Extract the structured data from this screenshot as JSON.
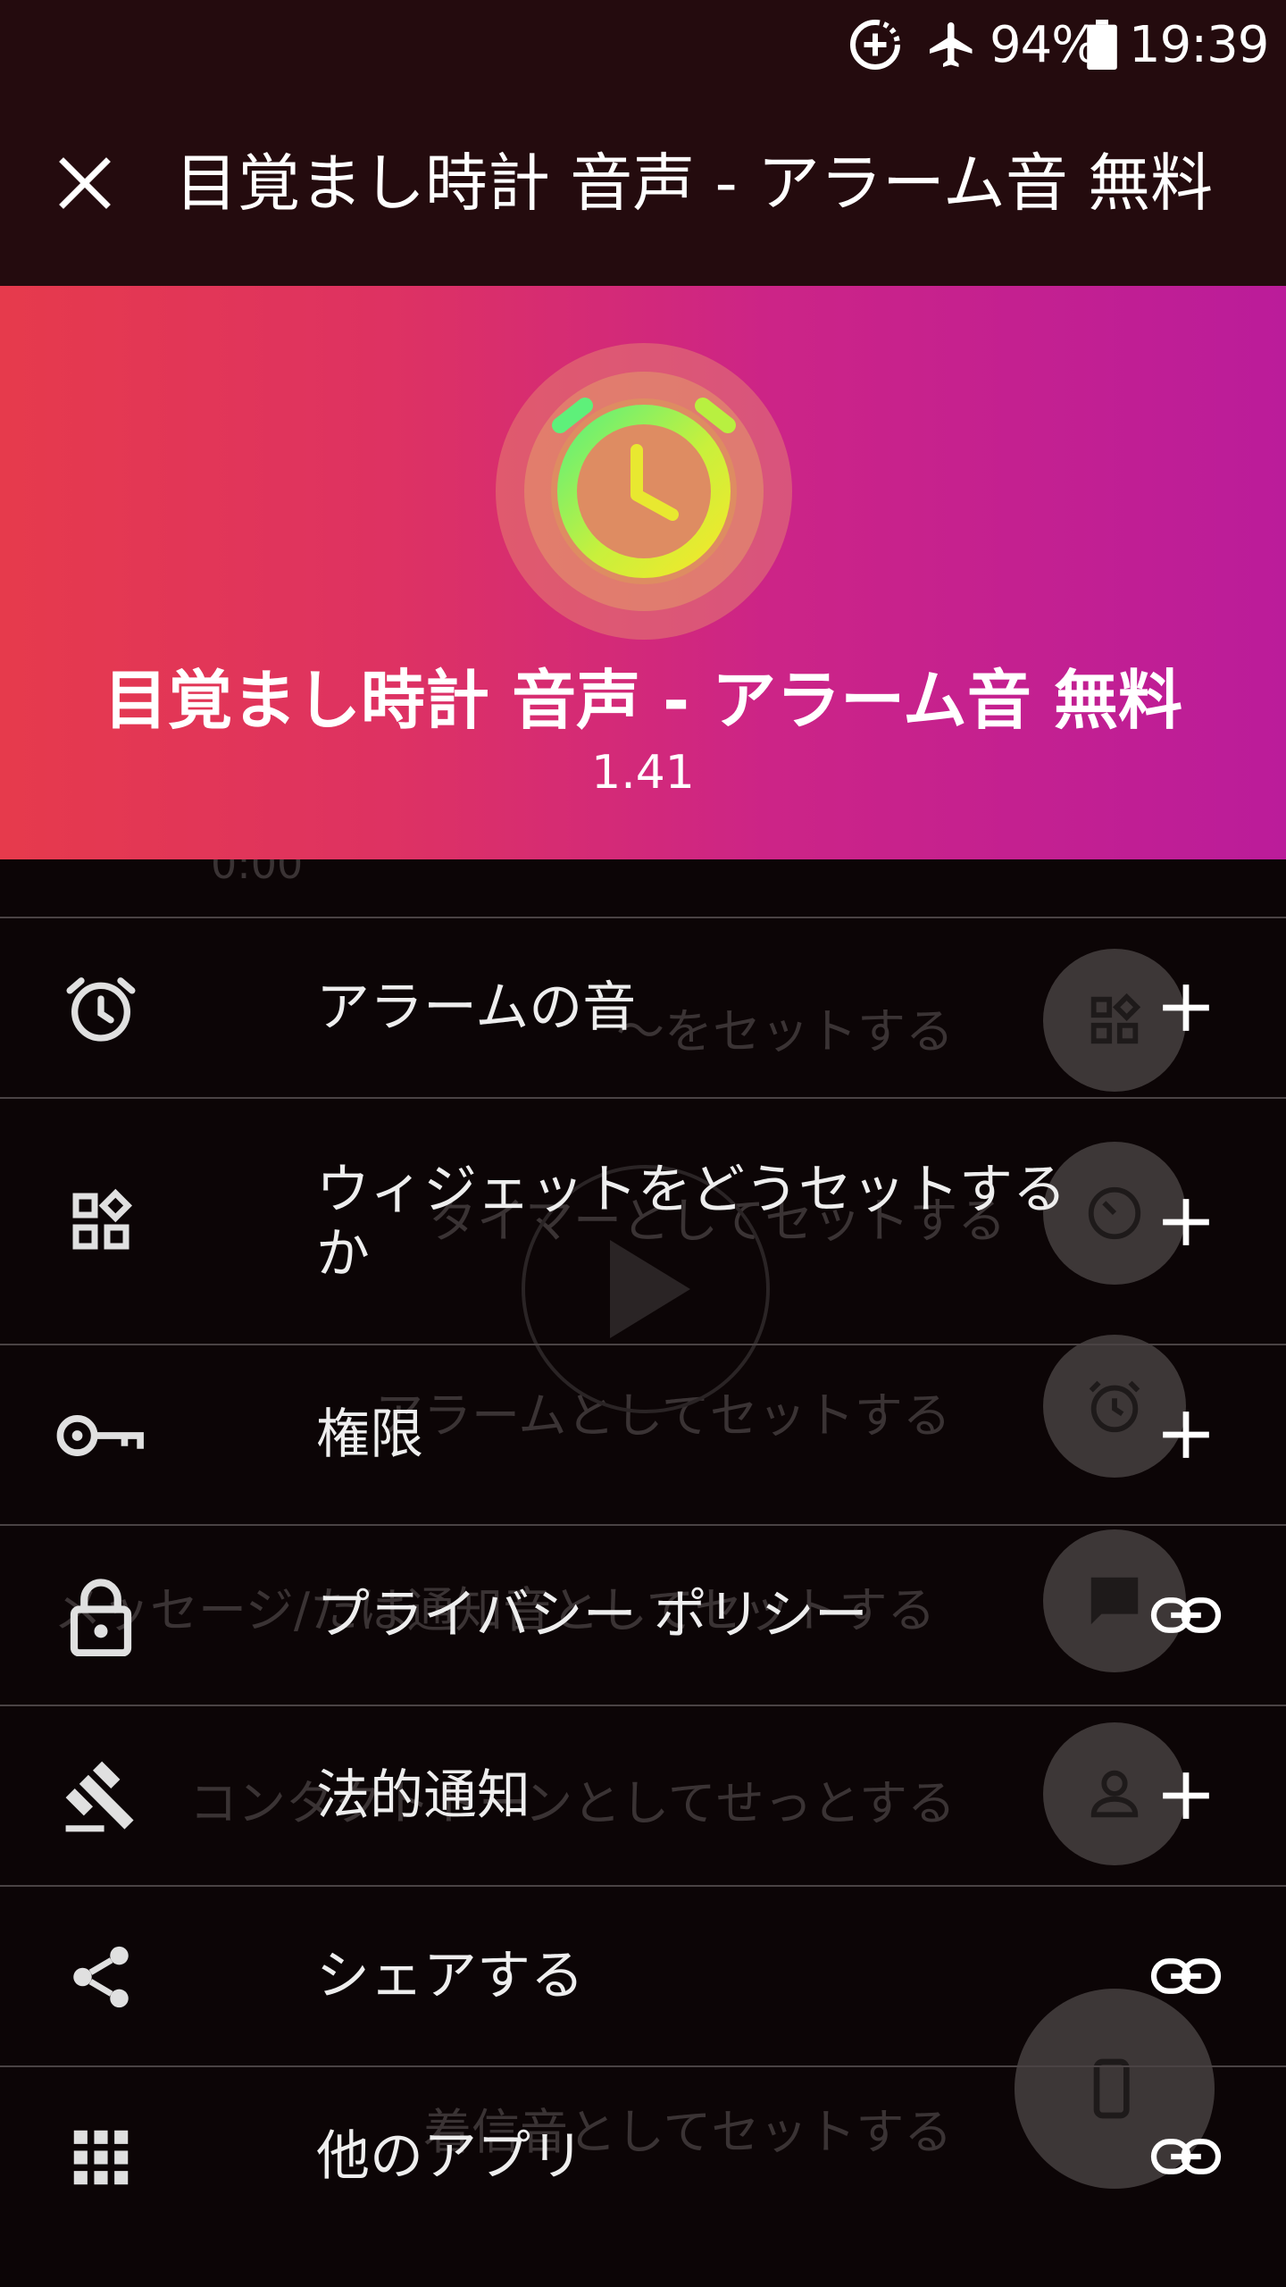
{
  "status_bar": {
    "battery_percent": "94%",
    "time": "19:39",
    "icons": [
      "data-saver-icon",
      "airplane-mode-icon",
      "battery-icon"
    ]
  },
  "app_bar": {
    "title": "目覚まし時計 音声 - アラーム音 無料",
    "close_icon": "close-icon"
  },
  "hero": {
    "title": "目覚まし時計 音声 - アラーム音 無料",
    "version": "1.41",
    "logo_icon": "alarm-clock-logo-icon",
    "gradient_start": "#e63a4c",
    "gradient_end": "#bb1c9a"
  },
  "menu": {
    "items": [
      {
        "label": "アラームの音",
        "icon": "alarm-icon",
        "action_icon": "plus-icon"
      },
      {
        "label": "ウィジェットをどうセットするか",
        "icon": "widgets-icon",
        "action_icon": "plus-icon"
      },
      {
        "label": "権限",
        "icon": "key-icon",
        "action_icon": "plus-icon"
      },
      {
        "label": "プライバシー ポリシー",
        "icon": "lock-icon",
        "action_icon": "link-icon"
      },
      {
        "label": "法的通知",
        "icon": "gavel-icon",
        "action_icon": "plus-icon"
      },
      {
        "label": "シェアする",
        "icon": "share-icon",
        "action_icon": "link-icon"
      },
      {
        "label": "他のアプリ",
        "icon": "apps-grid-icon",
        "action_icon": "link-icon"
      }
    ]
  },
  "background_screen": {
    "time_label": "0:00",
    "options": [
      "〜をセットする",
      "タイマーとしてセットする",
      "アラームとしてセットする",
      "メッセージ/たは通知音としてセットする",
      "コンタクトトーンとしてせっとする",
      "着信音としてセットする"
    ],
    "fab_icons": [
      "widgets-icon",
      "timer-icon",
      "alarm-icon",
      "message-icon",
      "person-icon",
      "phone-ring-icon"
    ]
  },
  "colors": {
    "bar_background": "#240b0e",
    "drawer_background": "#0c0506",
    "divider": "#4a4344",
    "text": "#eeeeee"
  }
}
